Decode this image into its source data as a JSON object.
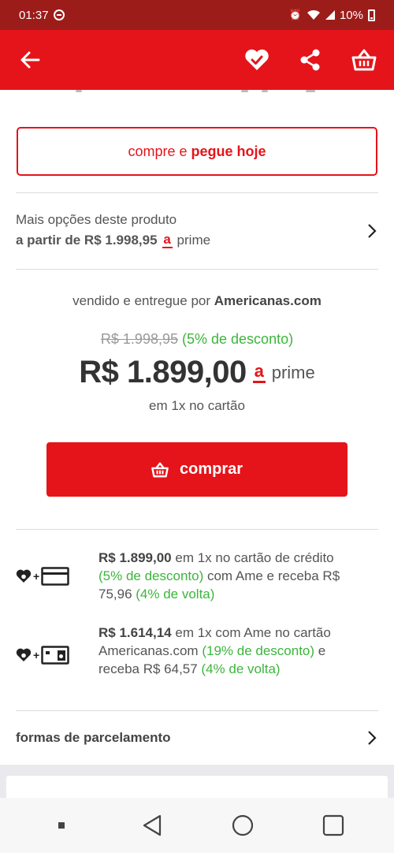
{
  "status_bar": {
    "time": "01:37",
    "battery": "10%"
  },
  "app_bar": {
    "back_icon": "arrow-left-icon",
    "favorite_icon": "heart-check-icon",
    "share_icon": "share-icon",
    "cart_icon": "basket-icon"
  },
  "pickup_button": {
    "prefix": "compre e",
    "bold": "pegue hoje"
  },
  "more_options": {
    "title": "Mais opções deste produto",
    "price_label": "a partir de R$ 1.998,95",
    "prime_mark": "a",
    "prime_word": "prime"
  },
  "seller": {
    "prefix": "vendido e entregue por",
    "name": "Americanas.com"
  },
  "pricing": {
    "old_price": "R$ 1.998,95",
    "discount": "(5% de desconto)",
    "price": "R$ 1.899,00",
    "prime_mark": "a",
    "prime_word": "prime",
    "installment": "em 1x no cartão"
  },
  "buy_button": {
    "label": "comprar",
    "icon": "basket-icon"
  },
  "offers": [
    {
      "icons": [
        "ame-heart-icon",
        "credit-card-icon"
      ],
      "price": "R$ 1.899,00",
      "t1": " em 1x no cartão de crédito ",
      "discount": "(5% de desconto)",
      "t2": " com Ame e receba R$ 75,96 ",
      "cashback": "(4% de volta)"
    },
    {
      "icons": [
        "ame-heart-icon",
        "americanas-card-icon"
      ],
      "price": "R$ 1.614,14",
      "t1": " em 1x com Ame no cartão Americanas.com ",
      "discount": "(19% de desconto)",
      "t2": " e receba R$ 64,57 ",
      "cashback": "(4% de volta)"
    }
  ],
  "parcelamento": {
    "label": "formas de parcelamento"
  },
  "colors": {
    "brand_red": "#e5141a",
    "status_red": "#9c1c1a",
    "discount_green": "#3cb53c"
  }
}
